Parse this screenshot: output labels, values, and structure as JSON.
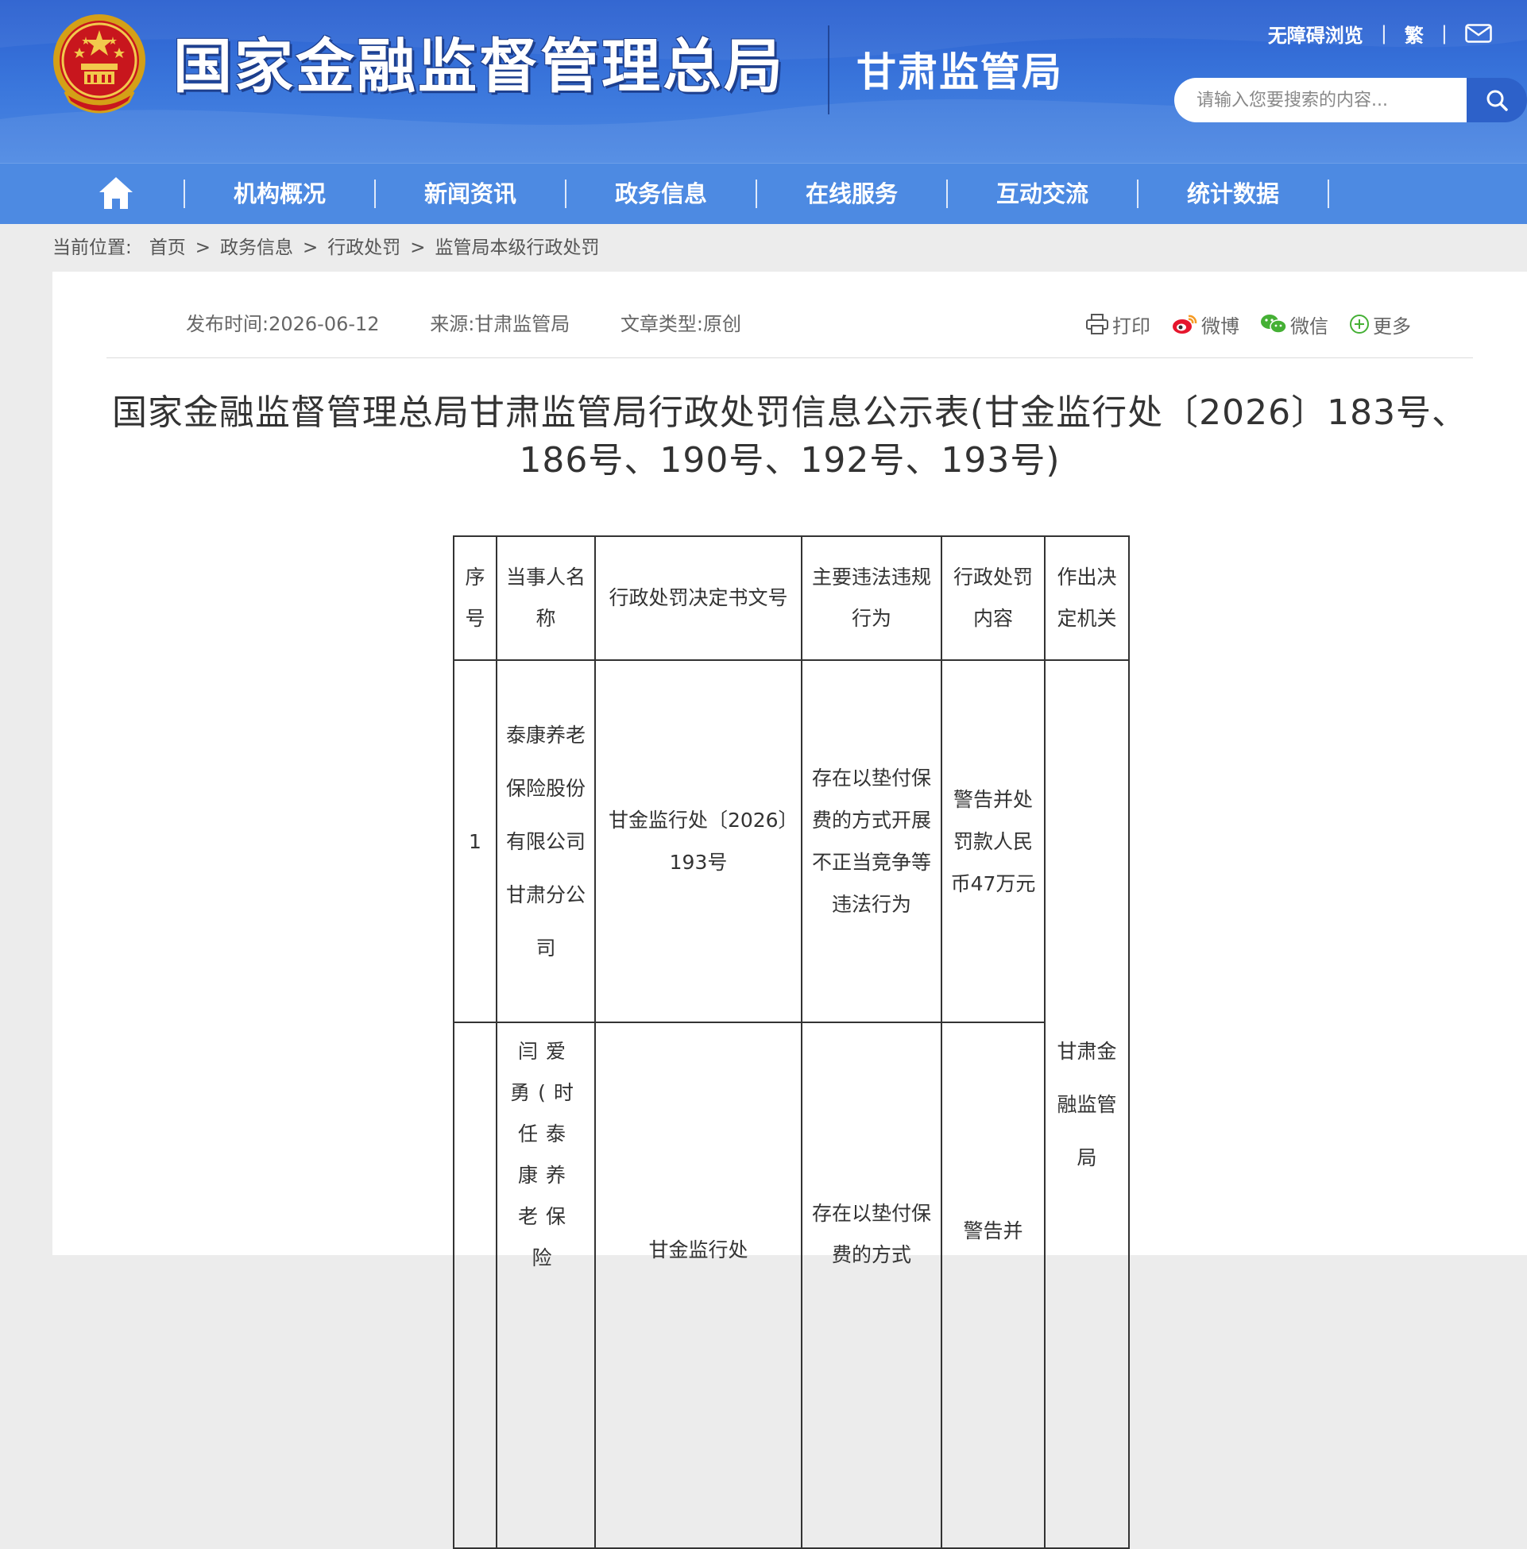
{
  "header": {
    "site_name": "国家金融监督管理总局",
    "sub_name": "甘肃监管局",
    "accessibility": "无障碍浏览",
    "traditional": "繁",
    "search_placeholder": "请输入您要搜索的内容..."
  },
  "nav": {
    "items": [
      "机构概况",
      "新闻资讯",
      "政务信息",
      "在线服务",
      "互动交流",
      "统计数据"
    ]
  },
  "breadcrumb": {
    "label": "当前位置:",
    "items": [
      "首页",
      "政务信息",
      "行政处罚",
      "监管局本级行政处罚"
    ]
  },
  "meta": {
    "publish": "发布时间:2026-06-12",
    "source": "来源:甘肃监管局",
    "type": "文章类型:原创"
  },
  "share": {
    "print": "打印",
    "weibo": "微博",
    "wechat": "微信",
    "more": "更多"
  },
  "article": {
    "title": "国家金融监督管理总局甘肃监管局行政处罚信息公示表(甘金监行处〔2026〕183号、186号、190号、192号、193号)"
  },
  "table": {
    "headers": [
      "序号",
      "当事人名称",
      "行政处罚决定书文号",
      "主要违法违规行为",
      "行政处罚内容",
      "作出决定机关"
    ],
    "rows": [
      {
        "no": "1",
        "party": "泰康养老保险股份有限公司甘肃分公司",
        "doc_no": "甘金监行处〔2026〕193号",
        "violation": "存在以垫付保费的方式开展不正当竞争等违法行为",
        "penalty": "警告并处罚款人民币47万元"
      },
      {
        "no": "",
        "party": "闫爱勇(时任泰康养老保险",
        "doc_no": "甘金监行处",
        "violation": "存在以垫付保费的方式",
        "penalty": "警告并"
      }
    ],
    "authority": "甘肃金融监管局"
  }
}
